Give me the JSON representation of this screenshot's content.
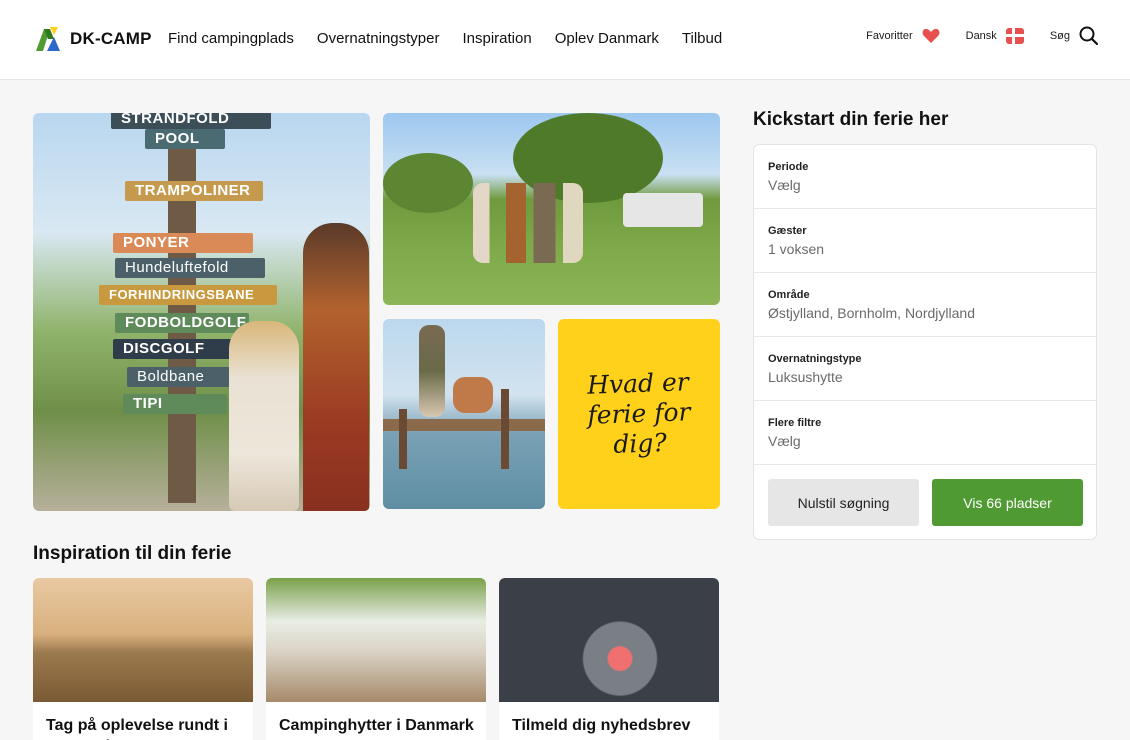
{
  "brand": {
    "name": "DK-CAMP"
  },
  "nav": {
    "items": [
      "Find campingplads",
      "Overnatningstyper",
      "Inspiration",
      "Oplev Danmark",
      "Tilbud"
    ]
  },
  "utility": {
    "favorites_label": "Favoritter",
    "language_label": "Dansk",
    "search_label": "Søg"
  },
  "hero": {
    "signs": [
      "STRANDFOLD",
      "POOL",
      "TRAMPOLINER",
      "PONYER",
      "Hundeluftefold",
      "FORHINDRINGSBANE",
      "FODBOLDGOLF",
      "DISCGOLF",
      "Boldbane",
      "TIPI"
    ],
    "promo_text": "Hvad er ferie for dig?"
  },
  "filter": {
    "title": "Kickstart din ferie her",
    "rows": [
      {
        "label": "Periode",
        "value": "Vælg"
      },
      {
        "label": "Gæster",
        "value": "1 voksen"
      },
      {
        "label": "Område",
        "value": "Østjylland, Bornholm, Nordjylland"
      },
      {
        "label": "Overnatningstype",
        "value": "Luksushytte"
      },
      {
        "label": "Flere filtre",
        "value": "Vælg"
      }
    ],
    "reset_label": "Nulstil søgning",
    "show_label": "Vis 66 pladser"
  },
  "inspiration": {
    "title": "Inspiration til din ferie",
    "cards": [
      {
        "title": "Tag på oplevelse rundt i Danmark"
      },
      {
        "title": "Campinghytter i Danmark"
      },
      {
        "title": "Tilmeld dig nyhedsbrev"
      }
    ]
  },
  "colors": {
    "accent_green": "#4f9a32",
    "promo_yellow": "#ffd11a",
    "heart_red": "#e8504f"
  }
}
